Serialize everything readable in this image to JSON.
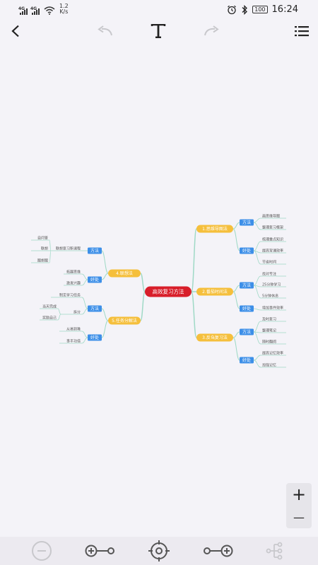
{
  "status_bar": {
    "sim1": "4G",
    "sim2": "4G",
    "net_speed_value": "1.2",
    "net_speed_unit": "K/s",
    "battery": "100",
    "time": "16:24"
  },
  "toolbar": {
    "back_icon": "back-arrow-icon",
    "undo_icon": "undo-icon",
    "text_style_icon": "text-format-icon",
    "redo_icon": "redo-icon",
    "menu_icon": "list-menu-icon"
  },
  "mindmap": {
    "root": "高效复习方法",
    "right_branches": [
      {
        "label": "1.思维导图法",
        "groups": [
          {
            "label": "方法",
            "leaves": [
              "画思维导图",
              "整理复习框架"
            ]
          },
          {
            "label": "好处",
            "leaves": [
              "梳理重点知识",
              "提高背诵效率",
              "节省时间"
            ]
          }
        ]
      },
      {
        "label": "2.番茄时间法",
        "groups": [
          {
            "label": "方法",
            "leaves": [
              "找对专注",
              "25分钟学习",
              "5分钟休息"
            ]
          },
          {
            "label": "好处",
            "leaves": [
              "增加事件效率"
            ]
          }
        ]
      },
      {
        "label": "3.反刍复习法",
        "groups": [
          {
            "label": "方法",
            "leaves": [
              "及时复习",
              "整理笔记",
              "随时翻阅"
            ]
          },
          {
            "label": "好处",
            "leaves": [
              "提高记忆效率",
              "加强记忆"
            ]
          }
        ]
      }
    ],
    "left_branches": [
      {
        "label": "4.联想法",
        "groups": [
          {
            "label": "方法",
            "leaves": [
              "联想复习新课程"
            ],
            "subleaves": [
              "自问答",
              "联想",
              "图想图"
            ]
          },
          {
            "label": "好处",
            "leaves": [
              "拓展思维",
              "激发兴趣"
            ]
          }
        ]
      },
      {
        "label": "5.任务分解法",
        "groups": [
          {
            "label": "方法",
            "leaves": [
              "制定学习任务",
              "拆分"
            ],
            "subleaves": [
              "当天完成",
              "奖励自己"
            ]
          },
          {
            "label": "好处",
            "leaves": [
              "从易到难",
              "事半功倍"
            ]
          }
        ]
      }
    ]
  },
  "zoom": {
    "plus": "+",
    "minus": "—"
  },
  "bottom_bar": [
    "zoom-out-circle-icon",
    "add-child-left-icon",
    "locate-center-icon",
    "add-child-right-icon",
    "structure-tree-icon"
  ],
  "colors": {
    "background": "#f4f3f8",
    "root_fill": "#d81e2a",
    "branch_fill": "#f5bf3c",
    "group_fill": "#3d8fe8",
    "connector": "#9fd9c6",
    "icon_dark": "#222222",
    "icon_disabled": "#c8c8cc"
  }
}
